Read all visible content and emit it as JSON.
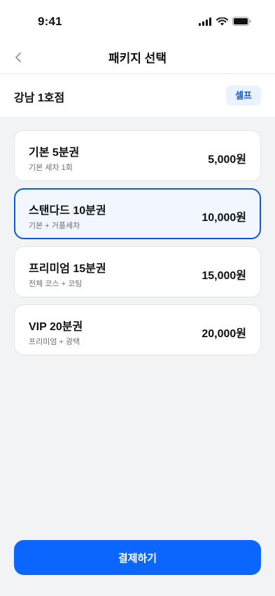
{
  "status_bar": {
    "time": "9:41"
  },
  "nav": {
    "title": "패키지 선택",
    "back_icon": "chevron-left-icon"
  },
  "store": {
    "name": "강남 1호점",
    "type_badge": "셀프"
  },
  "packages": [
    {
      "name": "기본 5분권",
      "desc": "기본 세차 1회",
      "price": "5,000원",
      "selected": false
    },
    {
      "name": "스탠다드 10분권",
      "desc": "기본 + 거품세차",
      "price": "10,000원",
      "selected": true
    },
    {
      "name": "프리미엄 15분권",
      "desc": "전체 코스 + 코팅",
      "price": "15,000원",
      "selected": false
    },
    {
      "name": "VIP 20분권",
      "desc": "프리미엄 + 광택",
      "price": "20,000원",
      "selected": false
    }
  ],
  "footer": {
    "pay_label": "결제하기"
  },
  "colors": {
    "accent": "#0a66ff",
    "selected_border": "#0a5adf",
    "selected_bg": "#f2f7ff"
  }
}
